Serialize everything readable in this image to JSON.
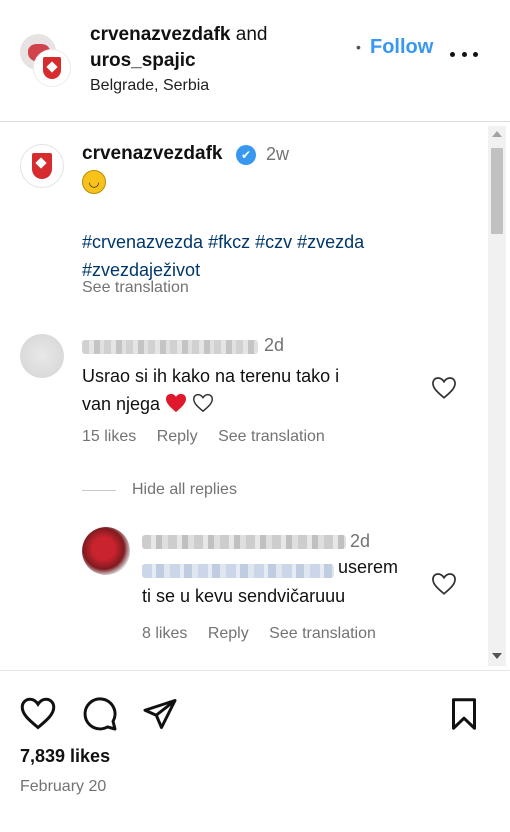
{
  "header": {
    "user1": "crvenazvezdafk",
    "and_text": "and",
    "user2": "uros_spajic",
    "location": "Belgrade, Serbia",
    "dot": "•",
    "follow_label": "Follow"
  },
  "caption": {
    "username": "crvenazvezdafk",
    "verified_icon": "✔",
    "time": "2w",
    "emoji": "upside-down-face",
    "emoji_glyph": "◡",
    "hashtags_line1": "#crvenazvezda #fkcz #czv #zvezda",
    "hashtags_line2": "#zvezdaježivot",
    "see_translation": "See translation"
  },
  "comments": [
    {
      "time": "2d",
      "text_line1": "Usrao si ih kako na terenu tako i",
      "text_line2": "van njega",
      "likes": "15 likes",
      "reply": "Reply",
      "see_translation": "See translation",
      "hide_replies": "Hide all replies"
    },
    {
      "time": "2d",
      "text_line1": "userem",
      "text_line2": "ti se u kevu sendvičaruuu",
      "likes": "8 likes",
      "reply": "Reply",
      "see_translation": "See translation"
    }
  ],
  "footer": {
    "likes": "7,839 likes",
    "date": "February 20"
  },
  "colors": {
    "link": "#00376b",
    "follow": "#3897f0",
    "muted": "#737373",
    "heart_red": "#e0182d"
  }
}
